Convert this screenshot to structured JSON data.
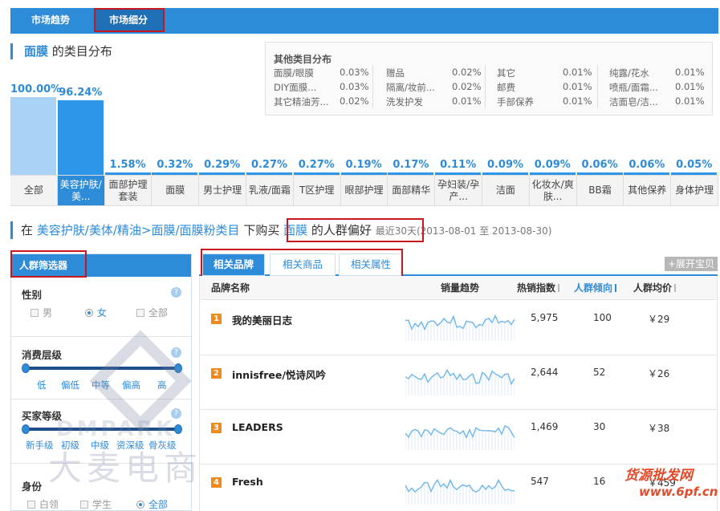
{
  "top_tabs": [
    "市场趋势",
    "市场细分"
  ],
  "distribution": {
    "category": "面膜",
    "title_suffix": "的类目分布"
  },
  "other_box": {
    "title": "其他类目分布",
    "items": [
      {
        "name": "面膜/眼膜",
        "value": "0.03%"
      },
      {
        "name": "DIY面膜...",
        "value": "0.03%"
      },
      {
        "name": "其它精油芳...",
        "value": "0.02%"
      },
      {
        "name": "赠品",
        "value": "0.02%"
      },
      {
        "name": "隔离/妆前...",
        "value": "0.02%"
      },
      {
        "name": "洗发护发",
        "value": "0.01%"
      },
      {
        "name": "其它",
        "value": "0.01%"
      },
      {
        "name": "邮费",
        "value": "0.01%"
      },
      {
        "name": "手部保养",
        "value": "0.01%"
      },
      {
        "name": "纯露/花水",
        "value": "0.01%"
      },
      {
        "name": "喷瓶/面霜...",
        "value": "0.01%"
      },
      {
        "name": "洁面皂/洁...",
        "value": "0.01%"
      }
    ]
  },
  "chart_data": {
    "type": "bar",
    "categories": [
      "全部",
      "美容护肤/美...",
      "面部护理套装",
      "面膜",
      "男士护理",
      "乳液/面霜",
      "T区护理",
      "眼部护理",
      "面部精华",
      "孕妇装/孕产...",
      "洁面",
      "化妆水/爽肤...",
      "BB霜",
      "其他保养",
      "身体护理"
    ],
    "values": [
      100.0,
      96.24,
      1.58,
      0.32,
      0.29,
      0.27,
      0.27,
      0.19,
      0.17,
      0.11,
      0.09,
      0.09,
      0.06,
      0.06,
      0.05
    ],
    "value_labels": [
      "100.00%",
      "96.24%",
      "1.58%",
      "0.32%",
      "0.29%",
      "0.27%",
      "0.27%",
      "0.19%",
      "0.17%",
      "0.11%",
      "0.09%",
      "0.09%",
      "0.06%",
      "0.06%",
      "0.05%"
    ],
    "active_index": 1,
    "colors": {
      "bar": "#2e96e8",
      "bar_all": "#a9d2f6"
    },
    "ylim": [
      0,
      100
    ]
  },
  "cat_labels": [
    [
      "全部"
    ],
    [
      "美容护肤/",
      "美..."
    ],
    [
      "面部护理",
      "套装"
    ],
    [
      "面膜"
    ],
    [
      "男士护理"
    ],
    [
      "乳液/面霜"
    ],
    [
      "T区护理"
    ],
    [
      "眼部护理"
    ],
    [
      "面部精华"
    ],
    [
      "孕妇装/孕",
      "产..."
    ],
    [
      "洁面"
    ],
    [
      "化妆水/爽",
      "肤..."
    ],
    [
      "BB霜"
    ],
    [
      "其他保养"
    ],
    [
      "身体护理"
    ]
  ],
  "crowd_title": {
    "prefix": "在",
    "path": "美容护肤/美体/精油>面膜/面膜粉类目",
    "mid": "下购买",
    "category": "面膜",
    "suffix": "的人群偏好",
    "period": "最近30天(2013-08-01 至 2013-08-30)"
  },
  "filter": {
    "header": "人群筛选器",
    "gender": {
      "label": "性别",
      "options": [
        "男",
        "女",
        "全部"
      ],
      "selected": "女"
    },
    "spend": {
      "label": "消费层级",
      "levels": [
        "低",
        "偏低",
        "中等",
        "偏高",
        "高"
      ]
    },
    "buyer": {
      "label": "买家等级",
      "levels": [
        "新手级",
        "初级",
        "中级",
        "资深级",
        "骨灰级"
      ]
    },
    "identity": {
      "label": "身份",
      "options": [
        "白领",
        "学生",
        "全部"
      ],
      "selected": "全部"
    }
  },
  "right_tabs": [
    "相关品牌",
    "相关商品",
    "相关属性"
  ],
  "expand_label": "+展开宝贝",
  "table": {
    "headers": [
      "品牌名称",
      "销量趋势",
      "热销指数",
      "人群倾向",
      "人群均价"
    ],
    "rows": [
      {
        "rank": "1",
        "name": "我的美丽日志",
        "hot": "5,975",
        "tend": "100",
        "price": "￥29"
      },
      {
        "rank": "2",
        "name": "innisfree/悦诗风吟",
        "hot": "2,644",
        "tend": "52",
        "price": "￥26"
      },
      {
        "rank": "3",
        "name": "LEADERS",
        "hot": "1,469",
        "tend": "30",
        "price": "￥38"
      },
      {
        "rank": "4",
        "name": "Fresh",
        "hot": "547",
        "tend": "16",
        "price": "￥459"
      }
    ]
  },
  "watermarks": {
    "brand_en": "DMPARK",
    "brand_cn": "大麦电商",
    "site1": "货源批发网",
    "site2": "www.6pf.cn"
  }
}
